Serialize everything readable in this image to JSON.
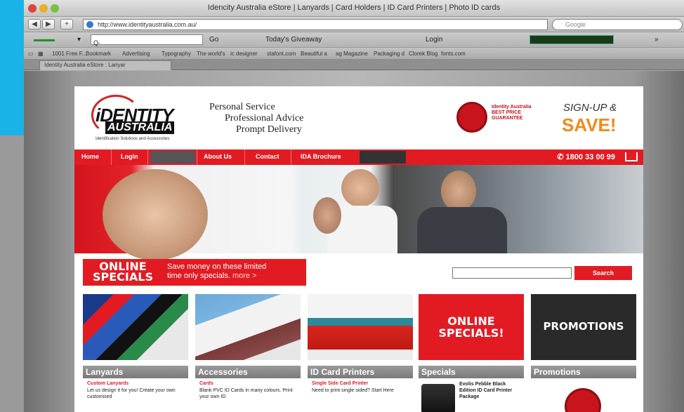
{
  "window": {
    "title": "Idencity Australia eStore | Lanyards | Card Holders | ID Card Printers | Photo ID cards"
  },
  "nav": {
    "url": "http://www.identityaustralia.com.au/",
    "search_placeholder": "Google"
  },
  "toolbar": {
    "input_placeholder": "Q-",
    "items": [
      "Go",
      "Today's Giveaway",
      "Login"
    ]
  },
  "bookmarks": [
    "1001 Free F...",
    "Bookmark",
    "Advertising",
    "Typography",
    "The world's",
    "ic designer",
    "stafont.com",
    "Beautiful a",
    "ag Magazine",
    "Packaging d",
    "Clorek Blog",
    "fonts.com"
  ],
  "tab": {
    "label": "Identity Australia eStore : Lanyar"
  },
  "site": {
    "logo_top": "iDENTITY",
    "logo_bottom": "AUSTRALIA",
    "logo_tag": "Identification Solutions and Accessories",
    "tagline1": "Personal Service",
    "tagline2": "Professional Advice",
    "tagline3": "Prompt Delivery",
    "badge_text": "Identity Australia BEST PRICE GUARANTEE",
    "signup": "SIGN-UP &",
    "save": "SAVE!",
    "menu": [
      "Home",
      "Login",
      "About Us",
      "Contact",
      "IDA Brochure"
    ],
    "phone": "1800 33 00 99",
    "specials_title1": "ONLINE",
    "specials_title2": "SPECIALS",
    "specials_text1": "Save money on these limited",
    "specials_text2": "time only specials.",
    "specials_more": "more >",
    "search_button": "Search",
    "columns": [
      {
        "head": "Lanyards",
        "link": "Custom Lanyards",
        "text": "Let us design it for you! Create your own customised"
      },
      {
        "head": "Accessories",
        "link": "Cards",
        "text": "Blank PVC ID Cards in many colours. Print your own ID"
      },
      {
        "head": "ID Card Printers",
        "link": "Single Side Card Printer",
        "text": "Need to print single sided? Start Here"
      },
      {
        "head": "Specials",
        "big": "ONLINE SPECIALS!",
        "text": "Evolis Pebble Black Edition ID Card Printer Package"
      },
      {
        "head": "Promotions",
        "big": "PROMOTIONS"
      }
    ]
  },
  "colors": {
    "brand_red": "#e21b23",
    "accent_orange": "#f08a1c",
    "cyan_edge": "#1ab3e8"
  }
}
